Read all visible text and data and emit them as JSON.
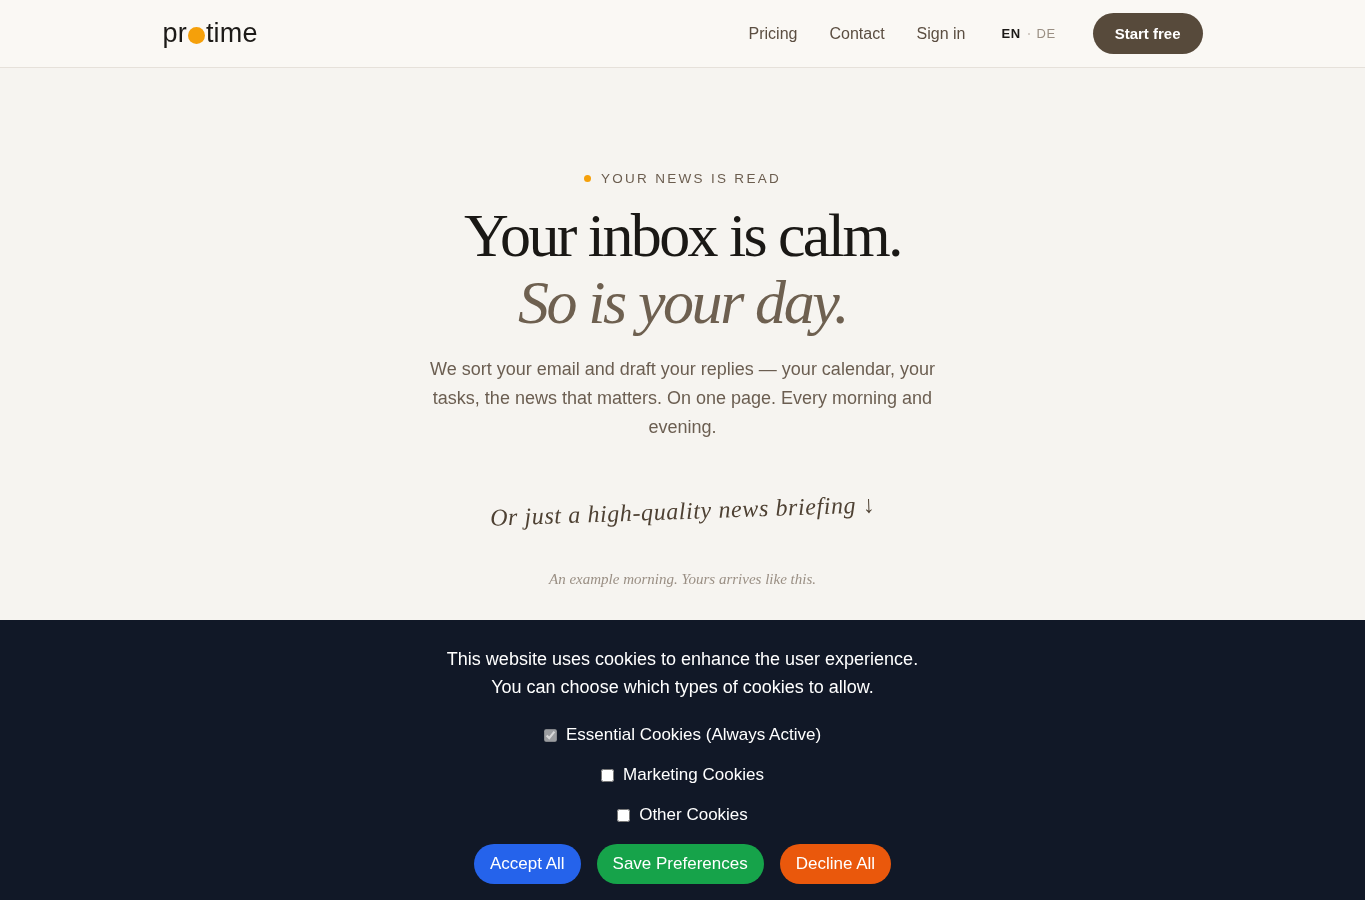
{
  "header": {
    "logo": {
      "prefix": "pr",
      "suffix": "time"
    },
    "nav": [
      "Pricing",
      "Contact",
      "Sign in"
    ],
    "languages": [
      {
        "label": "EN",
        "selected": true
      },
      {
        "label": "DE",
        "selected": false
      }
    ],
    "cta": "Start free"
  },
  "hero": {
    "eyebrow": "YOUR NEWS IS READ",
    "title": "Your inbox is calm.",
    "subtitle": "So is your day.",
    "description": "We sort your email and draft your replies — your calendar, your tasks, the news that matters. On one page. Every morning and evening.",
    "handwritten_note": "Or just a high-quality news briefing ↓",
    "caption": "An example morning. Yours arrives like this."
  },
  "cookie_banner": {
    "message": [
      "This website uses cookies to enhance the user experience.",
      "You can choose which types of cookies to allow."
    ],
    "options": [
      {
        "label": "Essential Cookies (Always Active)",
        "checked": true,
        "disabled": true
      },
      {
        "label": "Marketing Cookies",
        "checked": false,
        "disabled": false
      },
      {
        "label": "Other Cookies",
        "checked": false,
        "disabled": false
      }
    ],
    "buttons": [
      {
        "label": "Accept All",
        "kind": "accept"
      },
      {
        "label": "Save Preferences",
        "kind": "save"
      },
      {
        "label": "Decline All",
        "kind": "decline"
      }
    ]
  }
}
